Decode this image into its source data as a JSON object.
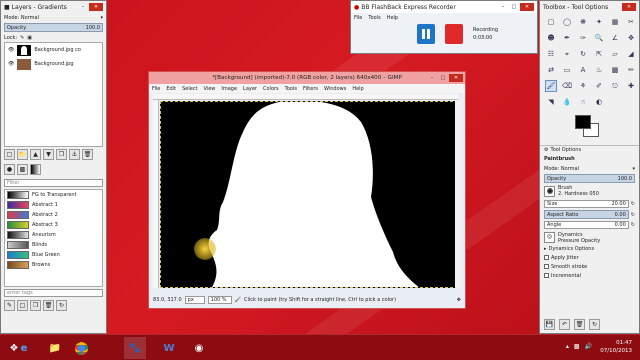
{
  "layers_window": {
    "title": "Layers - Gradients",
    "mode_label": "Mode: Normal",
    "opacity_label": "Opacity",
    "opacity_value": "100.0",
    "lock_label": "Lock:",
    "layers": [
      {
        "name": "Background.jpg co"
      },
      {
        "name": "Background.jpg"
      }
    ],
    "filter_placeholder": "Filter",
    "gradients": [
      {
        "name": "FG to Transparent",
        "c1": "#000000",
        "c2": "#ffffff"
      },
      {
        "name": "Abstract 1",
        "c1": "#3b2fa0",
        "c2": "#e8445a"
      },
      {
        "name": "Abstract 2",
        "c1": "#e23a4a",
        "c2": "#3c7ad8"
      },
      {
        "name": "Abstract 3",
        "c1": "#2a8f3c",
        "c2": "#d6d02a"
      },
      {
        "name": "Aneurism",
        "c1": "#111111",
        "c2": "#e0e0e0"
      },
      {
        "name": "Blinds",
        "c1": "#cccccc",
        "c2": "#555555"
      },
      {
        "name": "Blue Green",
        "c1": "#1d7fd0",
        "c2": "#35c07a"
      },
      {
        "name": "Browns",
        "c1": "#7a4a1f",
        "c2": "#d8a25e"
      }
    ],
    "tag_placeholder": "enter tags"
  },
  "recorder": {
    "title": "BB FlashBack Express Recorder",
    "menu": [
      "File",
      "Tools",
      "Help"
    ],
    "status_label": "Recording",
    "time": "0:03:00"
  },
  "gimp": {
    "title": "*[Background] (imported)-7.0 (RGB color, 2 layers) 640x400 – GIMP",
    "menu": [
      "File",
      "Edit",
      "Select",
      "View",
      "Image",
      "Layer",
      "Colors",
      "Tools",
      "Filters",
      "Windows",
      "Help"
    ],
    "coords": "83.0, 317.0",
    "unit": "px",
    "zoom": "100 %",
    "status": "Click to paint (try Shift for a straight line, Ctrl to pick a color)"
  },
  "toolbox": {
    "title": "Toolbox - Tool Options",
    "tool_options_label": "Tool Options",
    "tool_name": "Paintbrush",
    "mode_label": "Mode: Normal",
    "opacity_label": "Opacity",
    "opacity_value": "100.0",
    "brush_label": "Brush",
    "brush_name": "2. Hardness 050",
    "size_label": "Size",
    "size_value": "20.00",
    "aspect_label": "Aspect Ratio",
    "aspect_value": "0.00",
    "angle_label": "Angle",
    "angle_value": "0.00",
    "dynamics_label": "Dynamics",
    "dynamics_name": "Pressure Opacity",
    "dynamics_options_label": "Dynamics Options",
    "apply_jitter_label": "Apply Jitter",
    "smooth_stroke_label": "Smooth stroke",
    "incremental_label": "Incremental"
  },
  "taskbar": {
    "time": "01:47",
    "date": "07/10/2013"
  }
}
